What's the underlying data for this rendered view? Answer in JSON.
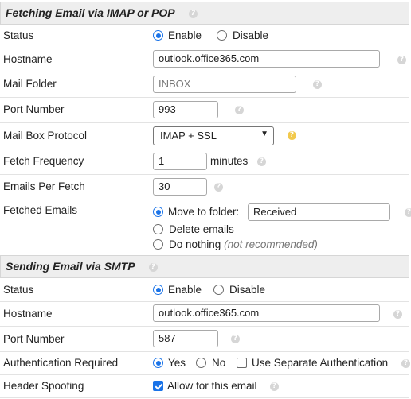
{
  "imap": {
    "title": "Fetching Email via IMAP or POP",
    "status": {
      "label": "Status",
      "enable": "Enable",
      "disable": "Disable",
      "selected": "Enable"
    },
    "hostname": {
      "label": "Hostname",
      "value": "outlook.office365.com"
    },
    "mail_folder": {
      "label": "Mail Folder",
      "placeholder": "INBOX"
    },
    "port": {
      "label": "Port Number",
      "value": "993"
    },
    "protocol": {
      "label": "Mail Box Protocol",
      "selected": "IMAP + SSL"
    },
    "frequency": {
      "label": "Fetch Frequency",
      "value": "1",
      "unit": "minutes"
    },
    "per_fetch": {
      "label": "Emails Per Fetch",
      "value": "30"
    },
    "fetched": {
      "label": "Fetched Emails",
      "move": "Move to folder:",
      "move_folder": "Received",
      "delete": "Delete emails",
      "nothing": "Do nothing",
      "nothing_note": "(not recommended)",
      "selected": "move"
    }
  },
  "smtp": {
    "title": "Sending Email via SMTP",
    "status": {
      "label": "Status",
      "enable": "Enable",
      "disable": "Disable",
      "selected": "Enable"
    },
    "hostname": {
      "label": "Hostname",
      "value": "outlook.office365.com"
    },
    "port": {
      "label": "Port Number",
      "value": "587"
    },
    "auth": {
      "label": "Authentication Required",
      "yes": "Yes",
      "no": "No",
      "selected": "Yes",
      "separate": "Use Separate Authentication",
      "separate_checked": false
    },
    "spoofing": {
      "label": "Header Spoofing",
      "allow": "Allow for this email",
      "allow_checked": true
    }
  },
  "help_glyph": "?",
  "colors": {
    "accent": "#1a73e8",
    "section_bg": "#eeeeee",
    "help_yellow": "#f2c94c"
  }
}
